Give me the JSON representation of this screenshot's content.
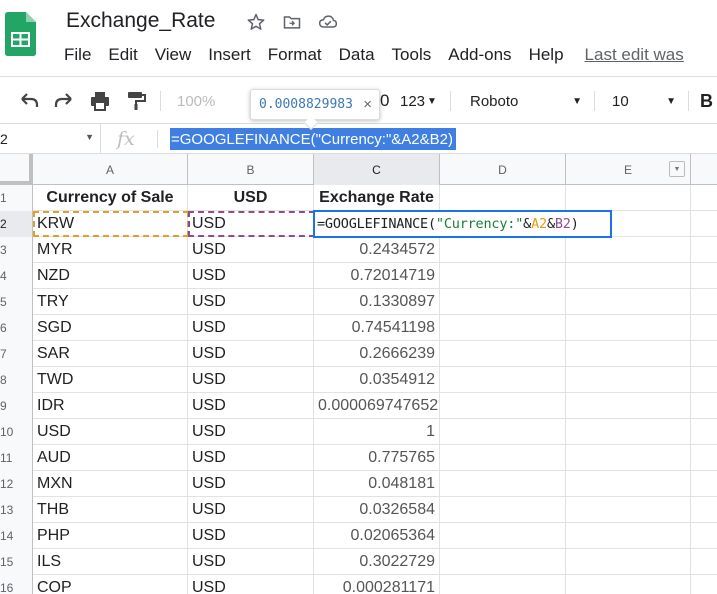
{
  "app": {
    "title": "Exchange_Rate",
    "menu": [
      "File",
      "Edit",
      "View",
      "Insert",
      "Format",
      "Data",
      "Tools",
      "Add-ons",
      "Help"
    ],
    "last_edit": "Last edit was"
  },
  "toolbar": {
    "zoom": "100%",
    "format_num": "123",
    "font": "Roboto",
    "font_size": "10",
    "bold": "B",
    "partial_digit": "0",
    "tooltip_value": "0.0008829983",
    "tooltip_close": "×"
  },
  "formula_bar": {
    "cell_ref": "2",
    "fx": "fx",
    "formula": "=GOOGLEFINANCE(\"Currency:\"&A2&B2)"
  },
  "columns": [
    "A",
    "B",
    "C",
    "D",
    "E"
  ],
  "headers": {
    "a": "Currency of Sale",
    "b": "USD",
    "c": "Exchange Rate"
  },
  "edit_cell": {
    "eq": "=GOOGLEFINANCE(",
    "str": "\"Currency:\"",
    "amp1": "&",
    "refA": "A2",
    "amp2": "&",
    "refB": "B2",
    "close": ")"
  },
  "rows": [
    {
      "n": "1"
    },
    {
      "n": "2",
      "a": "KRW",
      "b": "USD",
      "c": ""
    },
    {
      "n": "3",
      "a": "MYR",
      "b": "USD",
      "c": "0.2434572"
    },
    {
      "n": "4",
      "a": "NZD",
      "b": "USD",
      "c": "0.72014719"
    },
    {
      "n": "5",
      "a": "TRY",
      "b": "USD",
      "c": "0.1330897"
    },
    {
      "n": "6",
      "a": "SGD",
      "b": "USD",
      "c": "0.74541198"
    },
    {
      "n": "7",
      "a": "SAR",
      "b": "USD",
      "c": "0.2666239"
    },
    {
      "n": "8",
      "a": "TWD",
      "b": "USD",
      "c": "0.0354912"
    },
    {
      "n": "9",
      "a": "IDR",
      "b": "USD",
      "c": "0.000069747652"
    },
    {
      "n": "10",
      "a": "USD",
      "b": "USD",
      "c": "1"
    },
    {
      "n": "11",
      "a": "AUD",
      "b": "USD",
      "c": "0.775765"
    },
    {
      "n": "12",
      "a": "MXN",
      "b": "USD",
      "c": "0.048181"
    },
    {
      "n": "13",
      "a": "THB",
      "b": "USD",
      "c": "0.0326584"
    },
    {
      "n": "14",
      "a": "PHP",
      "b": "USD",
      "c": "0.02065364"
    },
    {
      "n": "15",
      "a": "ILS",
      "b": "USD",
      "c": "0.3022729"
    },
    {
      "n": "16",
      "a": "COP",
      "b": "USD",
      "c": "0.000281171"
    }
  ],
  "colors": {
    "accent": "#1a73e8",
    "selection": "#3f7fe1",
    "sheets_green": "#0f9d58"
  }
}
